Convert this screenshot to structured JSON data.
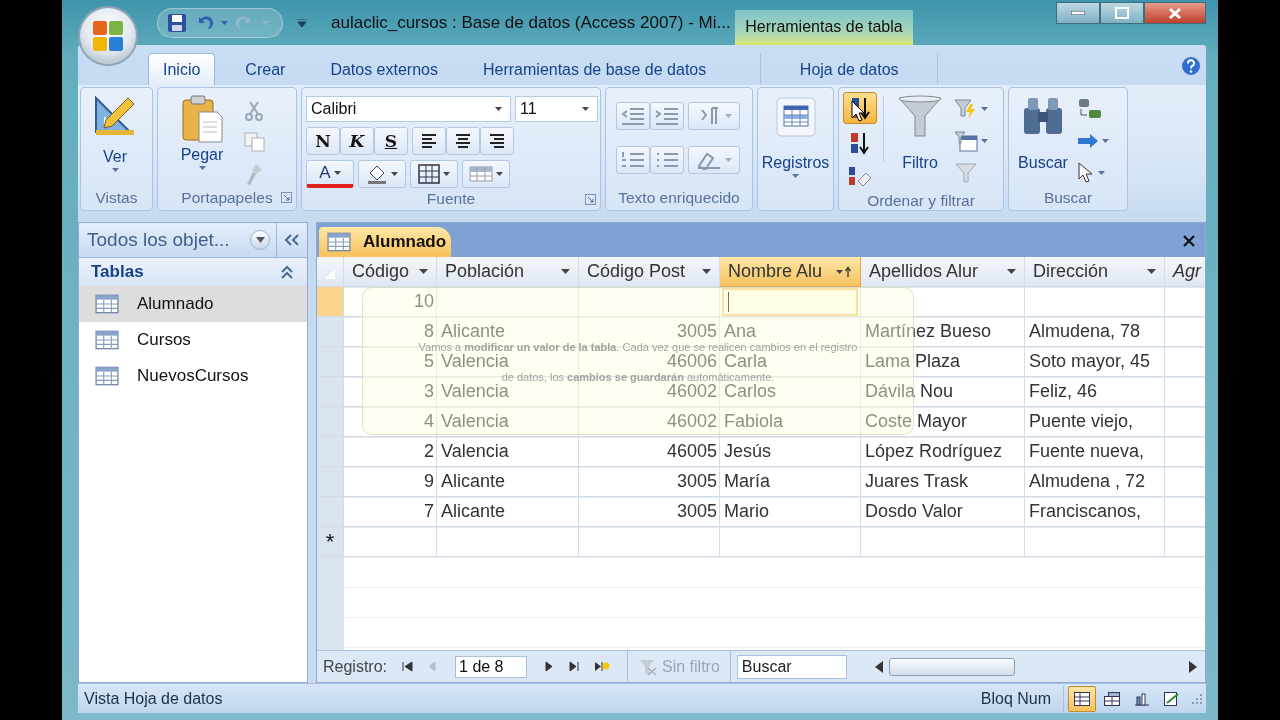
{
  "window": {
    "title": "aulaclic_cursos : Base de datos (Access 2007) - Mi...",
    "context_tab": "Herramientas de tabla"
  },
  "quick_access": [
    {
      "kind": "save",
      "disabled": false
    },
    {
      "kind": "undo",
      "disabled": false
    },
    {
      "kind": "redo",
      "disabled": true
    }
  ],
  "ribbon_tabs": [
    {
      "label": "Inicio",
      "selected": true,
      "contextual": false
    },
    {
      "label": "Crear",
      "selected": false,
      "contextual": false
    },
    {
      "label": "Datos externos",
      "selected": false,
      "contextual": false
    },
    {
      "label": "Herramientas de base de datos",
      "selected": false,
      "contextual": false
    },
    {
      "label": "Hoja de datos",
      "selected": false,
      "contextual": true
    }
  ],
  "ribbon_groups": [
    {
      "kind": "views",
      "label": "Vistas",
      "button": "Ver"
    },
    {
      "kind": "clipboard",
      "label": "Portapapeles",
      "button": "Pegar"
    },
    {
      "kind": "font",
      "label": "Fuente",
      "font_name": "Calibri",
      "font_size": "11",
      "format_buttons": [
        "N",
        "K",
        "S"
      ],
      "font_color_glyph": "A"
    },
    {
      "kind": "richtext",
      "label": "Texto enriquecido"
    },
    {
      "kind": "records",
      "button": "Registros"
    },
    {
      "kind": "sort_filter",
      "label": "Ordenar y filtrar",
      "button": "Filtro"
    },
    {
      "kind": "find",
      "label": "Buscar",
      "button": "Buscar"
    }
  ],
  "navigation_pane": {
    "header": "Todos los objet...",
    "sections": [
      {
        "label": "Tablas",
        "expanded": true,
        "items": [
          {
            "label": "Alumnado",
            "selected": true
          },
          {
            "label": "Cursos",
            "selected": false
          },
          {
            "label": "NuevosCursos",
            "selected": false
          }
        ]
      }
    ]
  },
  "datasheet": {
    "tab": "Alumnado",
    "columns": [
      {
        "label": "Código",
        "kind": "field",
        "numeric": true,
        "selected": false,
        "sorted": false
      },
      {
        "label": "Población",
        "kind": "field",
        "numeric": false,
        "selected": false,
        "sorted": false
      },
      {
        "label": "Código Post",
        "kind": "field",
        "numeric": true,
        "selected": false,
        "sorted": false
      },
      {
        "label": "Nombre Alu",
        "kind": "field",
        "numeric": false,
        "selected": true,
        "sorted": true
      },
      {
        "label": "Apellidos Alur",
        "kind": "field",
        "numeric": false,
        "selected": false,
        "sorted": false
      },
      {
        "label": "Dirección",
        "kind": "field",
        "numeric": false,
        "selected": false,
        "sorted": false
      },
      {
        "label": "Agr",
        "kind": "new_field",
        "selected": false
      }
    ],
    "rows": [
      {
        "selected": true,
        "cells": [
          "10",
          null,
          null,
          null,
          null,
          null
        ]
      },
      {
        "selected": false,
        "cells": [
          "8",
          "Alicante",
          "3005",
          "Ana",
          "Martínez Bueso",
          "Almudena, 78"
        ]
      },
      {
        "selected": false,
        "cells": [
          "5",
          "Valencia",
          "46006",
          "Carla",
          "Lama Plaza",
          "Soto mayor, 45"
        ]
      },
      {
        "selected": false,
        "cells": [
          "3",
          "Valencia",
          "46002",
          "Carlos",
          "Dávila Nou",
          "Feliz, 46"
        ]
      },
      {
        "selected": false,
        "cells": [
          "4",
          "Valencia",
          "46002",
          "Fabiola",
          "Coste Mayor",
          "Puente viejo,"
        ]
      },
      {
        "selected": false,
        "cells": [
          "2",
          "Valencia",
          "46005",
          "Jesús",
          "López Rodríguez",
          "Fuente nueva,"
        ]
      },
      {
        "selected": false,
        "cells": [
          "9",
          "Alicante",
          "3005",
          "María",
          "Juares Trask",
          "Almudena , 72"
        ]
      },
      {
        "selected": false,
        "cells": [
          "7",
          "Alicante",
          "3005",
          "Mario",
          "Dosdo Valor",
          "Franciscanos,"
        ]
      }
    ],
    "new_row_marker": "*",
    "tooltip": "Vamos a **modificar un valor de la tabla**. Cada vez que se realicen cambios en el registro de datos, los **cambios se guardarán** automáticamente.",
    "record_nav": {
      "label": "Registro:",
      "position": "1 de 8",
      "filter": "Sin filtro",
      "filter_active": false,
      "search_placeholder": "Buscar"
    }
  },
  "status_bar": {
    "left": "Vista Hoja de datos",
    "right": "Bloq Num",
    "view_buttons": [
      {
        "kind": "datasheet",
        "selected": true
      },
      {
        "kind": "pivot_table",
        "selected": false
      },
      {
        "kind": "pivot_chart",
        "selected": false
      },
      {
        "kind": "design",
        "selected": false
      }
    ]
  }
}
